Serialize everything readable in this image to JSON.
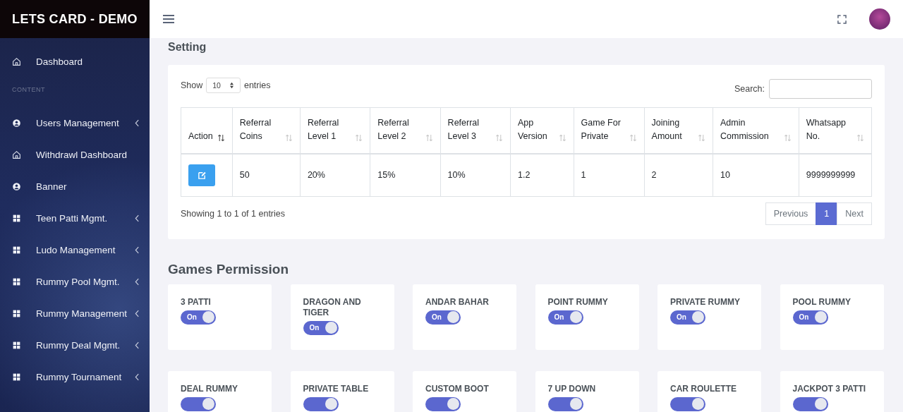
{
  "brand": {
    "title": "LETS CARD - DEMO"
  },
  "sidebar": {
    "items": [
      {
        "label": "Dashboard",
        "kind": "home",
        "expandable": false
      },
      {
        "kind": "section",
        "label": "CONTENT"
      },
      {
        "label": "Users Management",
        "kind": "user",
        "expandable": true
      },
      {
        "label": "Withdrawl Dashboard",
        "kind": "home",
        "expandable": false
      },
      {
        "label": "Banner",
        "kind": "user",
        "expandable": false
      },
      {
        "label": "Teen Patti Mgmt.",
        "kind": "grid",
        "expandable": true
      },
      {
        "label": "Ludo Management",
        "kind": "grid",
        "expandable": true
      },
      {
        "label": "Rummy Pool Mgmt.",
        "kind": "grid",
        "expandable": true
      },
      {
        "label": "Rummy Management",
        "kind": "grid",
        "expandable": true
      },
      {
        "label": "Rummy Deal Mgmt.",
        "kind": "grid",
        "expandable": true
      },
      {
        "label": "Rummy Tournament",
        "kind": "grid",
        "expandable": true
      }
    ]
  },
  "setting": {
    "title": "Setting",
    "length_menu": {
      "before": "Show",
      "value": "10",
      "after": "entries"
    },
    "search": {
      "label": "Search:"
    },
    "table": {
      "columns": [
        {
          "label": "Action",
          "sorted": true
        },
        {
          "label": "Referral Coins",
          "sorted": false
        },
        {
          "label": "Referral Level 1",
          "sorted": false
        },
        {
          "label": "Referral Level 2",
          "sorted": false
        },
        {
          "label": "Referral Level 3",
          "sorted": false
        },
        {
          "label": "App Version",
          "sorted": false
        },
        {
          "label": "Game For Private",
          "sorted": false
        },
        {
          "label": "Joining Amount",
          "sorted": false
        },
        {
          "label": "Admin Commission",
          "sorted": false
        },
        {
          "label": "Whatsapp No.",
          "sorted": false
        }
      ],
      "rows": [
        [
          {
            "kind": "edit"
          },
          {
            "kind": "text",
            "text": "50"
          },
          {
            "kind": "text",
            "text": "20%"
          },
          {
            "kind": "text",
            "text": "15%"
          },
          {
            "kind": "text",
            "text": "10%"
          },
          {
            "kind": "text",
            "text": "1.2"
          },
          {
            "kind": "text",
            "text": "1"
          },
          {
            "kind": "text",
            "text": "2"
          },
          {
            "kind": "text",
            "text": "10"
          },
          {
            "kind": "text",
            "text": "9999999999"
          }
        ]
      ]
    },
    "info": "Showing 1 to 1 of 1 entries",
    "pagination": [
      {
        "label": "Previous",
        "selected": false
      },
      {
        "label": "1",
        "selected": true
      },
      {
        "label": "Next",
        "selected": false
      }
    ]
  },
  "games_permission": {
    "title": "Games Permission",
    "games": [
      {
        "name": "3 PATTI",
        "on": true,
        "toggle_label": "On"
      },
      {
        "name": "DRAGON AND TIGER",
        "on": true,
        "toggle_label": "On"
      },
      {
        "name": "ANDAR BAHAR",
        "on": true,
        "toggle_label": "On"
      },
      {
        "name": "POINT RUMMY",
        "on": true,
        "toggle_label": "On"
      },
      {
        "name": "PRIVATE RUMMY",
        "on": true,
        "toggle_label": "On"
      },
      {
        "name": "POOL RUMMY",
        "on": true,
        "toggle_label": "On"
      },
      {
        "name": "DEAL RUMMY",
        "on": true
      },
      {
        "name": "PRIVATE TABLE",
        "on": true
      },
      {
        "name": "CUSTOM BOOT",
        "on": true
      },
      {
        "name": "7 UP DOWN",
        "on": true
      },
      {
        "name": "CAR ROULETTE",
        "on": true
      },
      {
        "name": "JACKPOT 3 PATTI",
        "on": true
      }
    ]
  }
}
